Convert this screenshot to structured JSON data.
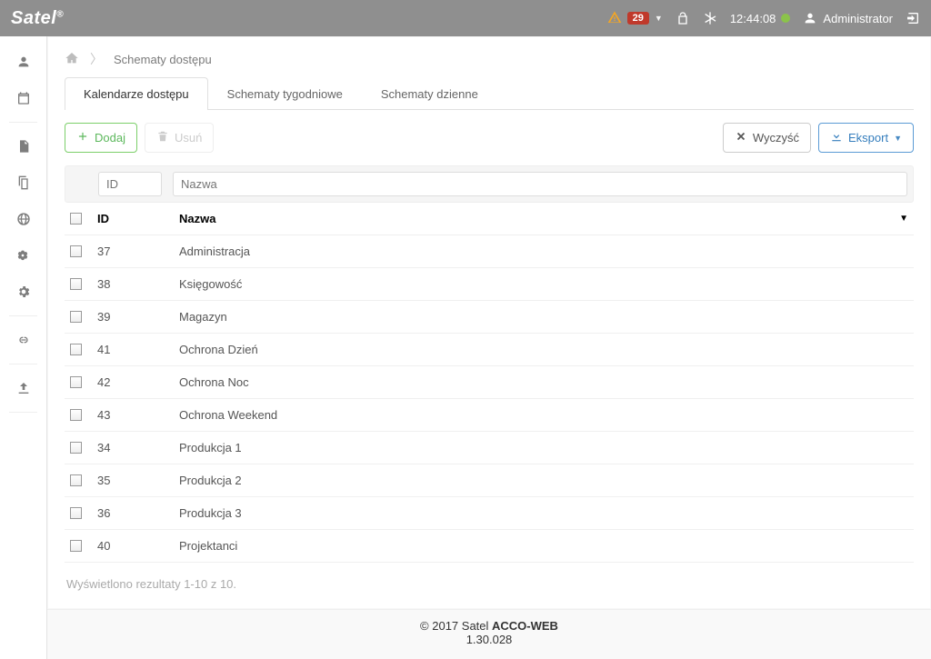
{
  "topbar": {
    "logo_text": "Satel",
    "notifications_count": "29",
    "time": "12:44:08",
    "user_label": "Administrator"
  },
  "breadcrumb": {
    "current": "Schematy dostępu"
  },
  "tabs": [
    {
      "label": "Kalendarze dostępu",
      "active": true
    },
    {
      "label": "Schematy tygodniowe",
      "active": false
    },
    {
      "label": "Schematy dzienne",
      "active": false
    }
  ],
  "toolbar": {
    "add_label": "Dodaj",
    "delete_label": "Usuń",
    "clear_label": "Wyczyść",
    "export_label": "Eksport"
  },
  "filters": {
    "id_placeholder": "ID",
    "name_placeholder": "Nazwa"
  },
  "columns": {
    "id": "ID",
    "name": "Nazwa"
  },
  "rows": [
    {
      "id": "37",
      "name": "Administracja"
    },
    {
      "id": "38",
      "name": "Księgowość"
    },
    {
      "id": "39",
      "name": "Magazyn"
    },
    {
      "id": "41",
      "name": "Ochrona Dzień"
    },
    {
      "id": "42",
      "name": "Ochrona Noc"
    },
    {
      "id": "43",
      "name": "Ochrona Weekend"
    },
    {
      "id": "34",
      "name": "Produkcja 1"
    },
    {
      "id": "35",
      "name": "Produkcja 2"
    },
    {
      "id": "36",
      "name": "Produkcja 3"
    },
    {
      "id": "40",
      "name": "Projektanci"
    }
  ],
  "results_text": "Wyświetlono rezultaty 1-10 z 10.",
  "footer": {
    "copyright_prefix": "© 2017 Satel ",
    "brand": "ACCO-WEB",
    "version": "1.30.028"
  }
}
